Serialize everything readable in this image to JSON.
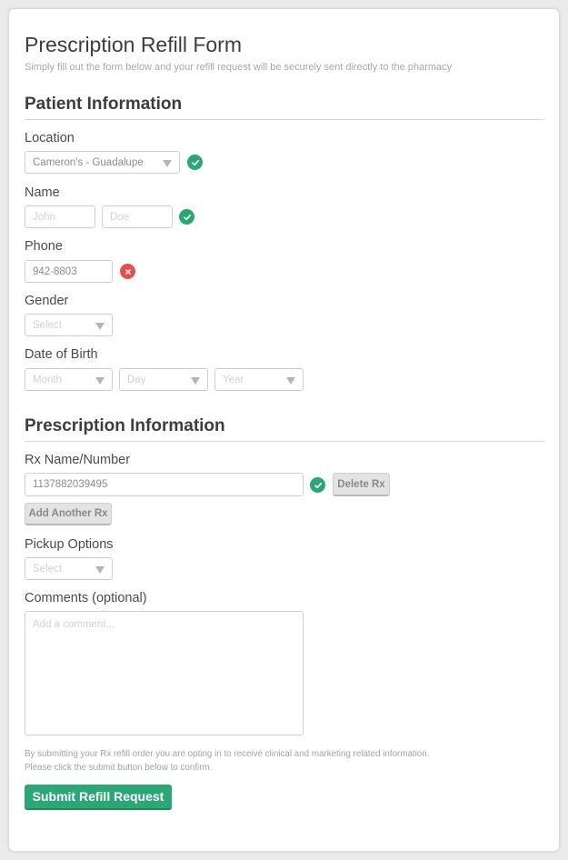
{
  "form": {
    "title": "Prescription Refill Form",
    "subtitle": "Simply fill out the form below and your refill request will be securely sent directly to the pharmacy"
  },
  "patient": {
    "section_title": "Patient Information",
    "location": {
      "label": "Location",
      "value": "Cameron's - Guadalupe",
      "status": "valid"
    },
    "name": {
      "label": "Name",
      "first_placeholder": "John",
      "last_placeholder": "Doe",
      "status": "valid"
    },
    "phone": {
      "label": "Phone",
      "value": "942-8803",
      "status": "invalid"
    },
    "gender": {
      "label": "Gender",
      "placeholder": "Select"
    },
    "dob": {
      "label": "Date of Birth",
      "month_placeholder": "Month",
      "day_placeholder": "Day",
      "year_placeholder": "Year"
    }
  },
  "prescription": {
    "section_title": "Prescription Information",
    "rx": {
      "label": "Rx Name/Number",
      "value": "1137882039495",
      "status": "valid",
      "delete_label": "Delete Rx"
    },
    "add_label": "Add Another Rx",
    "pickup": {
      "label": "Pickup Options",
      "placeholder": "Select"
    },
    "comments": {
      "label": "Comments (optional)",
      "placeholder": "Add a comment..."
    }
  },
  "legal": {
    "line1": "By submitting your Rx refill order you are opting in to receive clinical and marketing related information.",
    "line2": "Please click the submit button below to confirm."
  },
  "submit_label": "Submit Refill Request",
  "colors": {
    "accent": "#2aa775",
    "error": "#e25151",
    "border": "#cfcfcf"
  }
}
